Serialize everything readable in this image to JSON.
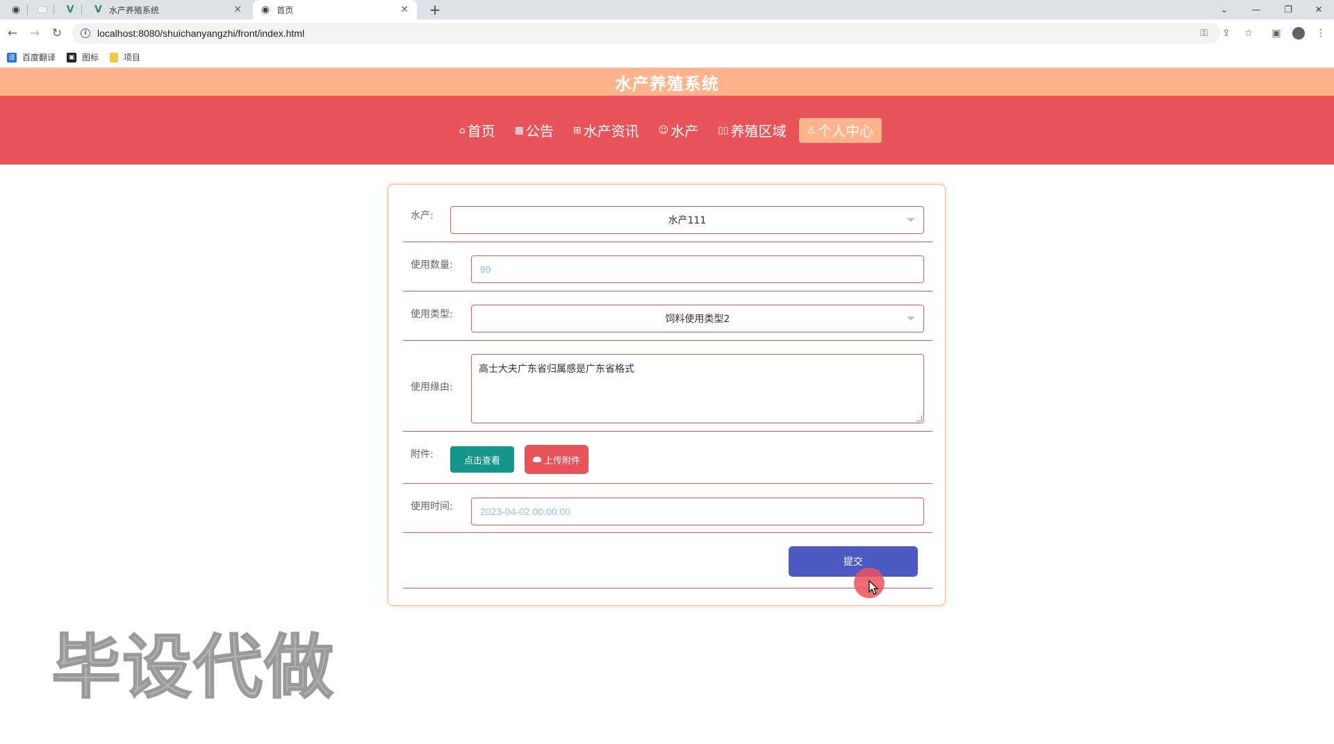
{
  "browser": {
    "tabs": [
      {
        "title": "水产养殖系统",
        "icon": "vue-logo-icon"
      },
      {
        "title": "首页",
        "icon": "globe-icon"
      }
    ],
    "new_tab_label": "+",
    "url": "localhost:8080/shuichanyangzhi/front/index.html",
    "bookmarks": [
      {
        "label": "百度翻译",
        "icon": "translate-icon",
        "color": "#2a6fdb",
        "glyph": "译"
      },
      {
        "label": "图标",
        "icon": "image-icon",
        "color": "#202124",
        "glyph": "▣"
      },
      {
        "label": "项目",
        "icon": "folder-icon",
        "color": "#f4c542",
        "glyph": ""
      }
    ]
  },
  "site": {
    "title": "水产养殖系统",
    "colors": {
      "accent": "#e9545a",
      "highlight": "#ffb38a",
      "submit": "#4d5ac4",
      "view": "#14978a"
    },
    "nav": [
      {
        "label": "首页",
        "icon": "home-icon",
        "glyph": "⌂"
      },
      {
        "label": "公告",
        "icon": "gift-icon",
        "glyph": "▦"
      },
      {
        "label": "水产资讯",
        "icon": "grid-icon",
        "glyph": "⊞"
      },
      {
        "label": "水产",
        "icon": "smile-icon",
        "glyph": "☺"
      },
      {
        "label": "养殖区域",
        "icon": "columns-icon",
        "glyph": "▯▯"
      },
      {
        "label": "个人中心",
        "icon": "user-icon",
        "glyph": "♙",
        "active": true
      }
    ]
  },
  "form": {
    "aquatic": {
      "label": "水产:",
      "value": "水产111"
    },
    "quantity": {
      "label": "使用数量:",
      "value": "99"
    },
    "usage_type": {
      "label": "使用类型:",
      "value": "饲料使用类型2"
    },
    "reason": {
      "label": "使用缘由:",
      "value": "高士大夫广东省归属感是广东省格式"
    },
    "attachment": {
      "label": "附件:",
      "view_label": "点击查看",
      "upload_label": "上传附件"
    },
    "use_time": {
      "label": "使用时间:",
      "value": "2023-04-02 00:00:00"
    },
    "submit_label": "提交"
  },
  "watermark": "毕设代做"
}
